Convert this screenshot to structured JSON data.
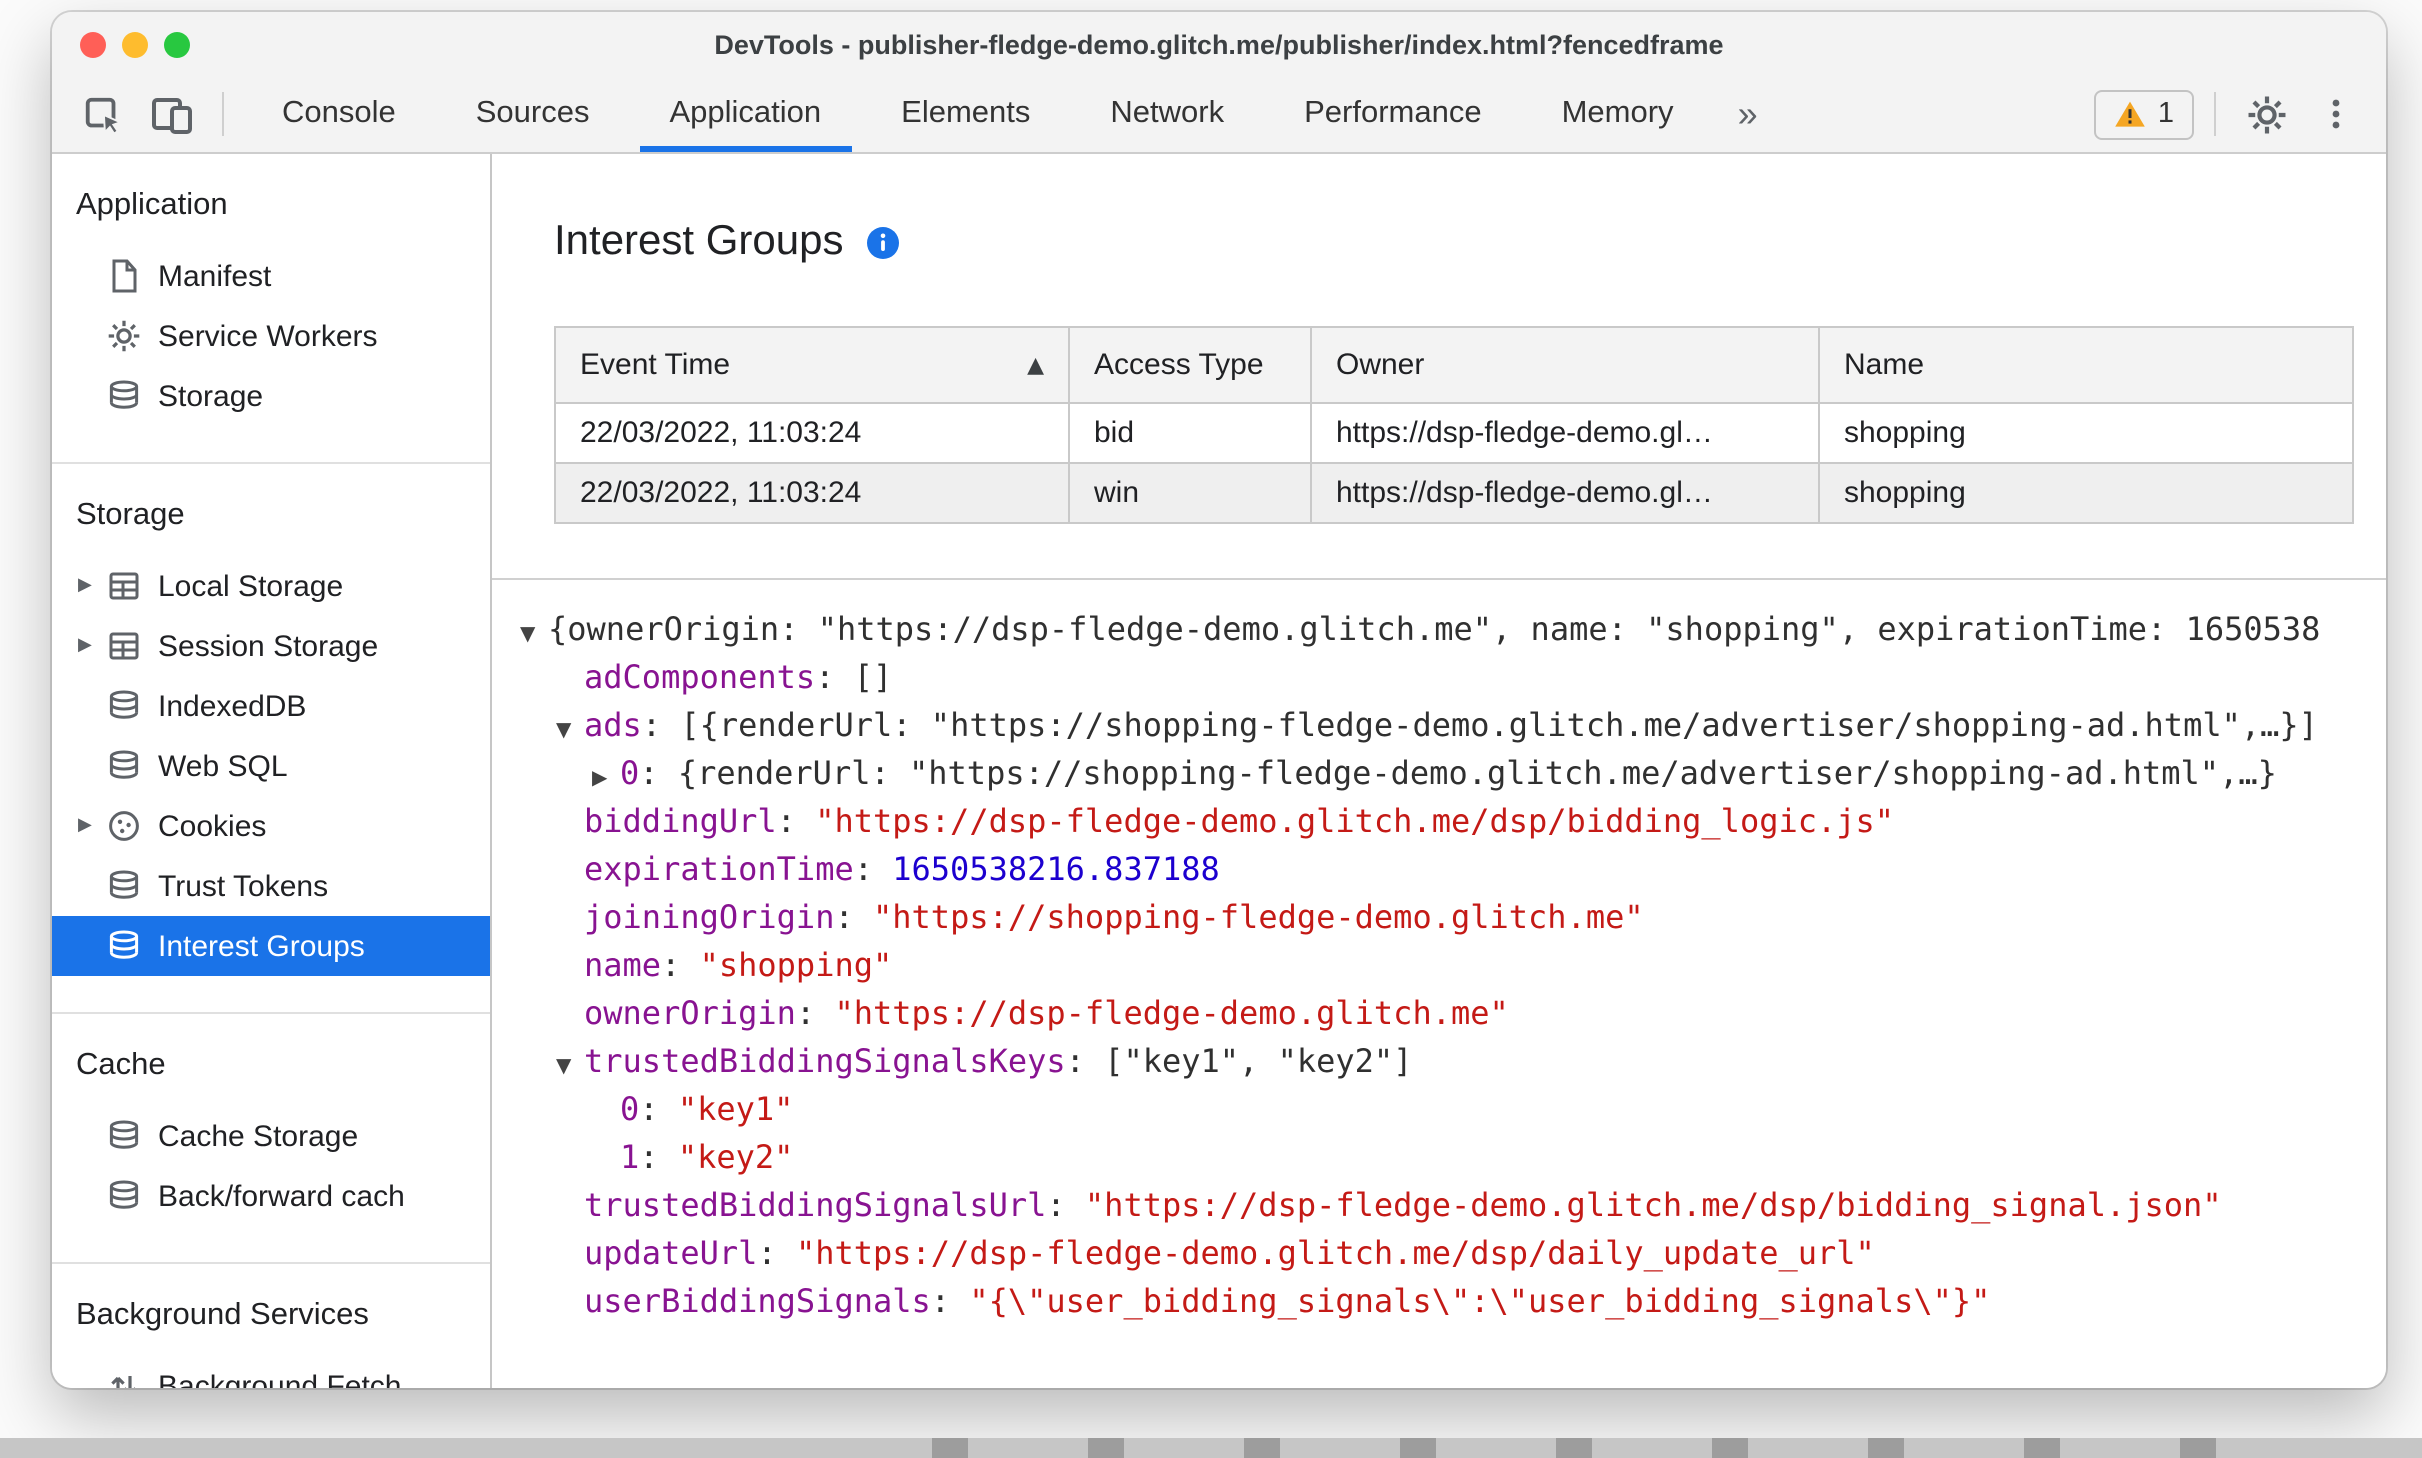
{
  "colors": {
    "accent": "#1a73e8",
    "selection_bg": "#1a73e8",
    "selection_text": "#ffffff",
    "chrome_bg": "#f3f3f3",
    "json_key": "#881391",
    "json_string": "#c41a16",
    "json_number": "#1c00cf",
    "warning": "#f5a623",
    "traffic_red": "#ff5f57",
    "traffic_yellow": "#febc2e",
    "traffic_green": "#28c840"
  },
  "window": {
    "title": "DevTools - publisher-fledge-demo.glitch.me/publisher/index.html?fencedframe"
  },
  "toolbar": {
    "tabs": [
      {
        "label": "Console"
      },
      {
        "label": "Sources"
      },
      {
        "label": "Application",
        "active": true
      },
      {
        "label": "Elements"
      },
      {
        "label": "Network"
      },
      {
        "label": "Performance"
      },
      {
        "label": "Memory"
      }
    ],
    "overflow_label": "»",
    "warning_count": "1"
  },
  "sidebar": {
    "sections": [
      {
        "title": "Application",
        "items": [
          {
            "label": "Manifest",
            "icon": "document"
          },
          {
            "label": "Service Workers",
            "icon": "gear"
          },
          {
            "label": "Storage",
            "icon": "database"
          }
        ]
      },
      {
        "title": "Storage",
        "items": [
          {
            "label": "Local Storage",
            "icon": "table",
            "expandable": true
          },
          {
            "label": "Session Storage",
            "icon": "table",
            "expandable": true
          },
          {
            "label": "IndexedDB",
            "icon": "database"
          },
          {
            "label": "Web SQL",
            "icon": "database"
          },
          {
            "label": "Cookies",
            "icon": "cookie",
            "expandable": true
          },
          {
            "label": "Trust Tokens",
            "icon": "database"
          },
          {
            "label": "Interest Groups",
            "icon": "database",
            "selected": true
          }
        ]
      },
      {
        "title": "Cache",
        "items": [
          {
            "label": "Cache Storage",
            "icon": "database"
          },
          {
            "label": "Back/forward cach",
            "icon": "database"
          }
        ]
      },
      {
        "title": "Background Services",
        "items": [
          {
            "label": "Background Fetch",
            "icon": "fetch"
          }
        ]
      }
    ]
  },
  "main": {
    "title": "Interest Groups",
    "table": {
      "columns": [
        {
          "label": "Event Time",
          "sort": "asc"
        },
        {
          "label": "Access Type"
        },
        {
          "label": "Owner"
        },
        {
          "label": "Name"
        }
      ],
      "rows": [
        [
          "22/03/2022, 11:03:24",
          "bid",
          "https://dsp-fledge-demo.gl…",
          "shopping"
        ],
        [
          "22/03/2022, 11:03:24",
          "win",
          "https://dsp-fledge-demo.gl…",
          "shopping"
        ]
      ]
    },
    "tree": [
      {
        "level": 0,
        "arrow": "open",
        "segments": [
          [
            "plain",
            "{ownerOrigin: \"https://dsp-fledge-demo.glitch.me\", name: \"shopping\", expirationTime: 1650538"
          ]
        ]
      },
      {
        "level": 1,
        "arrow": null,
        "segments": [
          [
            "key",
            "adComponents"
          ],
          [
            "plain",
            ": []"
          ]
        ]
      },
      {
        "level": 1,
        "arrow": "open",
        "segments": [
          [
            "key",
            "ads"
          ],
          [
            "plain",
            ": [{renderUrl: \"https://shopping-fledge-demo.glitch.me/advertiser/shopping-ad.html\",…}]"
          ]
        ]
      },
      {
        "level": 2,
        "arrow": "closed",
        "segments": [
          [
            "key",
            "0"
          ],
          [
            "plain",
            ": {renderUrl: \"https://shopping-fledge-demo.glitch.me/advertiser/shopping-ad.html\",…}"
          ]
        ]
      },
      {
        "level": 1,
        "arrow": null,
        "segments": [
          [
            "key",
            "biddingUrl"
          ],
          [
            "plain",
            ": "
          ],
          [
            "str",
            "\"https://dsp-fledge-demo.glitch.me/dsp/bidding_logic.js\""
          ]
        ]
      },
      {
        "level": 1,
        "arrow": null,
        "segments": [
          [
            "key",
            "expirationTime"
          ],
          [
            "plain",
            ": "
          ],
          [
            "num",
            "1650538216.837188"
          ]
        ]
      },
      {
        "level": 1,
        "arrow": null,
        "segments": [
          [
            "key",
            "joiningOrigin"
          ],
          [
            "plain",
            ": "
          ],
          [
            "str",
            "\"https://shopping-fledge-demo.glitch.me\""
          ]
        ]
      },
      {
        "level": 1,
        "arrow": null,
        "segments": [
          [
            "key",
            "name"
          ],
          [
            "plain",
            ": "
          ],
          [
            "str",
            "\"shopping\""
          ]
        ]
      },
      {
        "level": 1,
        "arrow": null,
        "segments": [
          [
            "key",
            "ownerOrigin"
          ],
          [
            "plain",
            ": "
          ],
          [
            "str",
            "\"https://dsp-fledge-demo.glitch.me\""
          ]
        ]
      },
      {
        "level": 1,
        "arrow": "open",
        "segments": [
          [
            "key",
            "trustedBiddingSignalsKeys"
          ],
          [
            "plain",
            ": [\"key1\", \"key2\"]"
          ]
        ]
      },
      {
        "level": 2,
        "arrow": null,
        "segments": [
          [
            "key",
            "0"
          ],
          [
            "plain",
            ": "
          ],
          [
            "str",
            "\"key1\""
          ]
        ]
      },
      {
        "level": 2,
        "arrow": null,
        "segments": [
          [
            "key",
            "1"
          ],
          [
            "plain",
            ": "
          ],
          [
            "str",
            "\"key2\""
          ]
        ]
      },
      {
        "level": 1,
        "arrow": null,
        "segments": [
          [
            "key",
            "trustedBiddingSignalsUrl"
          ],
          [
            "plain",
            ": "
          ],
          [
            "str",
            "\"https://dsp-fledge-demo.glitch.me/dsp/bidding_signal.json\""
          ]
        ]
      },
      {
        "level": 1,
        "arrow": null,
        "segments": [
          [
            "key",
            "updateUrl"
          ],
          [
            "plain",
            ": "
          ],
          [
            "str",
            "\"https://dsp-fledge-demo.glitch.me/dsp/daily_update_url\""
          ]
        ]
      },
      {
        "level": 1,
        "arrow": null,
        "segments": [
          [
            "key",
            "userBiddingSignals"
          ],
          [
            "plain",
            ": "
          ],
          [
            "str",
            "\"{\\\"user_bidding_signals\\\":\\\"user_bidding_signals\\\"}\""
          ]
        ]
      }
    ]
  }
}
